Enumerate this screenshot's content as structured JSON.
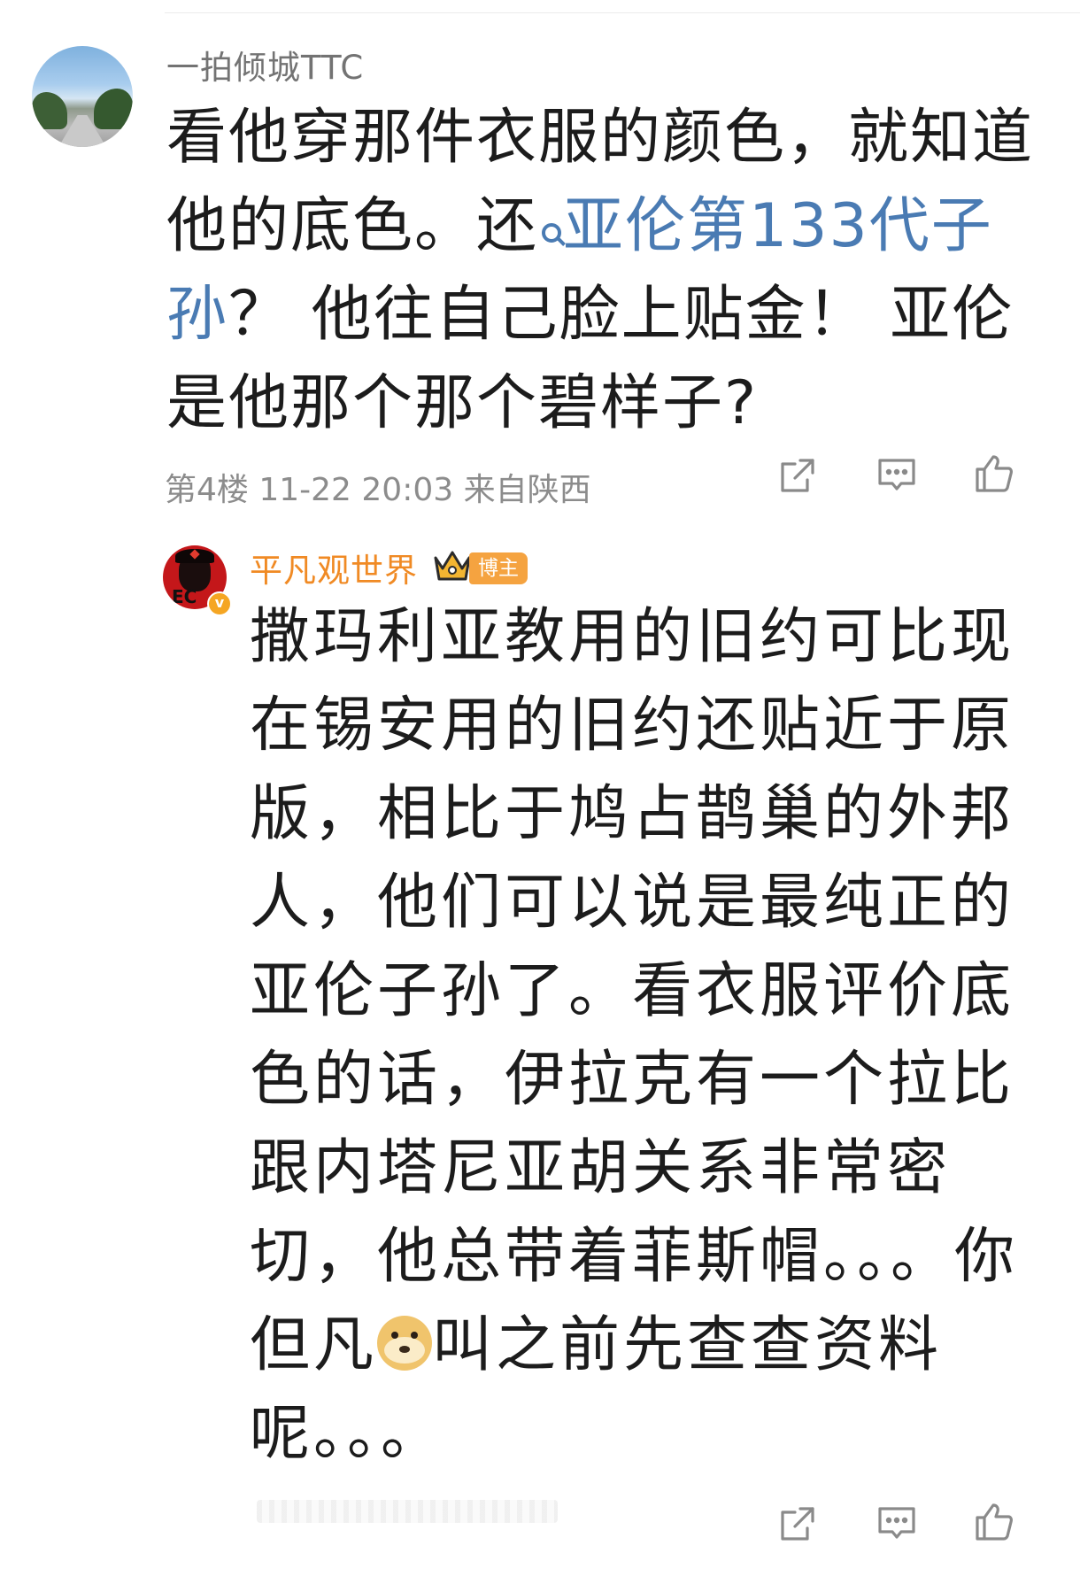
{
  "comment1": {
    "username": "一拍倾城TTC",
    "text_before_topic": "看他穿那件衣服的颜色，就知道他的底色。还",
    "topic": "亚伦第133代子孙",
    "text_after_topic": "？ 他往自己脸上贴金！ 亚伦是他那个那个碧样子?",
    "meta": "第4楼 11-22 20:03 来自陕西"
  },
  "comment2": {
    "username": "平凡观世界",
    "badge": "博主",
    "verify": "v",
    "avatar_text": "EC",
    "text_before_emoji": "撒玛利亚教用的旧约可比现在锡安用的旧约还贴近于原版，相比于鸠占鹊巢的外邦人，他们可以说是最纯正的亚伦子孙了。看衣服评价底色的话，伊拉克有一个拉比跟内塔尼亚胡关系非常密切，他总带着菲斯帽。。。你但凡",
    "emoji": "doge-emoji",
    "text_after_emoji": "叫之前先查查资料呢。。。"
  },
  "colors": {
    "link": "#4a7bb3",
    "username_highlight": "#f08a24",
    "badge_bg": "#f5a340",
    "meta": "#8c8c8c"
  },
  "icons": [
    "share-icon",
    "comment-icon",
    "like-icon"
  ]
}
